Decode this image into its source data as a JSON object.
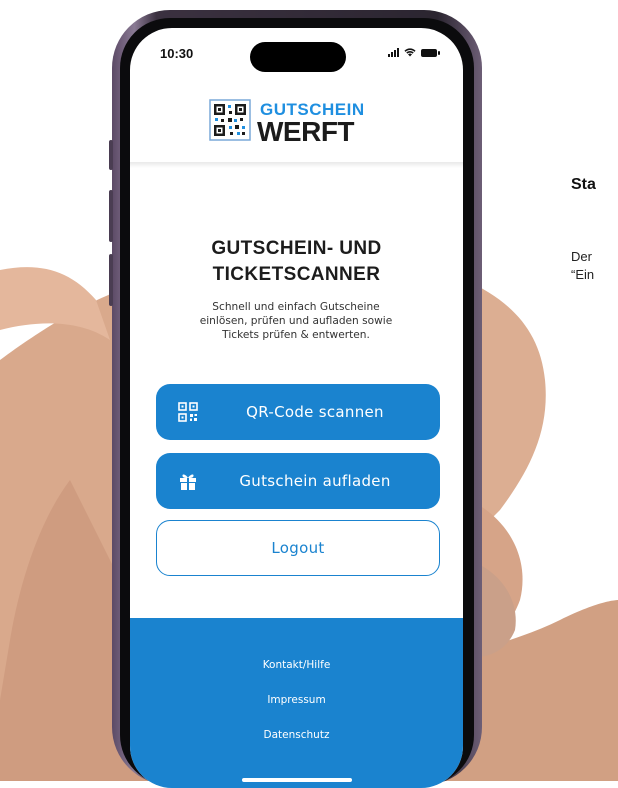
{
  "status_bar": {
    "time": "10:30"
  },
  "logo": {
    "top_text": "GUTSCHEIN",
    "bottom_text": "WERFT"
  },
  "main": {
    "title_line1": "GUTSCHEIN- UND",
    "title_line2": "TICKETSCANNER",
    "description_line1": "Schnell und einfach Gutscheine",
    "description_line2": "einlösen, prüfen und aufladen sowie",
    "description_line3": "Tickets prüfen & entwerten."
  },
  "buttons": {
    "scan_label": "QR-Code scannen",
    "scan_icon": "qr-code-icon",
    "topup_label": "Gutschein aufladen",
    "topup_icon": "gift-icon",
    "logout_label": "Logout"
  },
  "footer": {
    "links": [
      "Kontakt/Hilfe",
      "Impressum",
      "Datenschutz"
    ]
  },
  "side_text": {
    "heading": "Sta",
    "line1": "Der",
    "line2": "“Ein"
  },
  "colors": {
    "accent": "#1a83cf",
    "logo_blue": "#1f8fe0"
  }
}
